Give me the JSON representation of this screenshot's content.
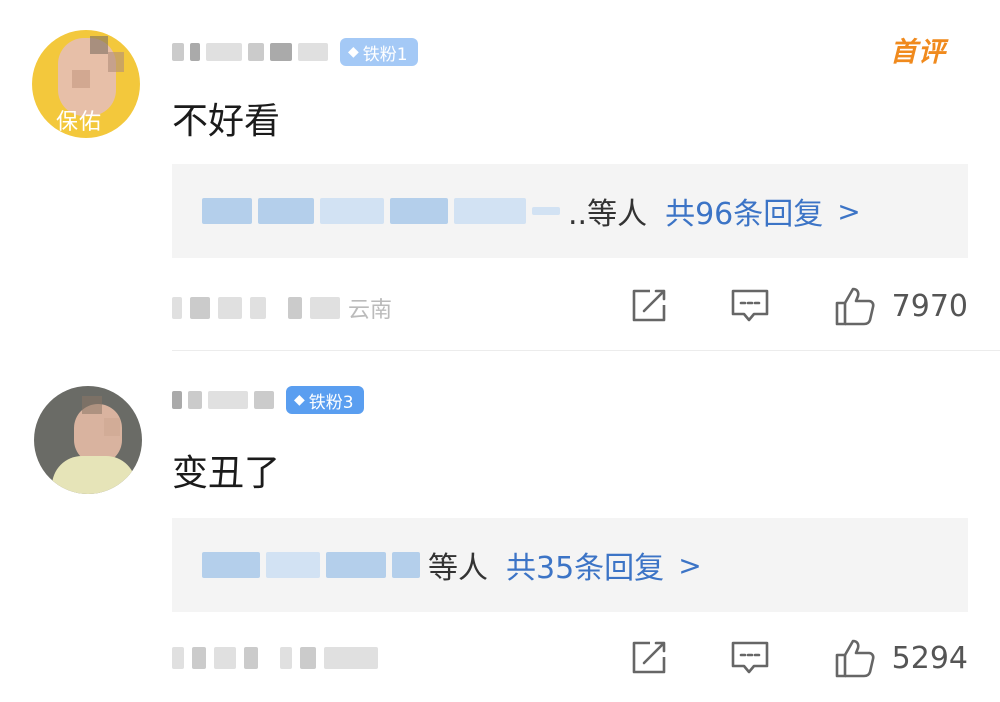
{
  "comments": [
    {
      "avatar_text": "保佑",
      "badge": "铁粉1",
      "first_tag": "首评",
      "content": "不好看",
      "reply_others": "..等人",
      "reply_count": "共96条回复",
      "reply_chevron": ">",
      "meta_suffix": "云南",
      "likes": "7970"
    },
    {
      "badge": "铁粉3",
      "content": "变丑了",
      "reply_others": "等人",
      "reply_count": "共35条回复",
      "reply_chevron": ">",
      "likes": "5294"
    }
  ],
  "icons": {
    "badge_gem": "diamond-icon",
    "share": "share-icon",
    "reply": "comment-icon",
    "like": "thumbs-up-icon"
  },
  "colors": {
    "link_blue": "#3c74c6",
    "badge_blue": "#5a9ef0",
    "first_tag_orange": "#f08a1d"
  }
}
